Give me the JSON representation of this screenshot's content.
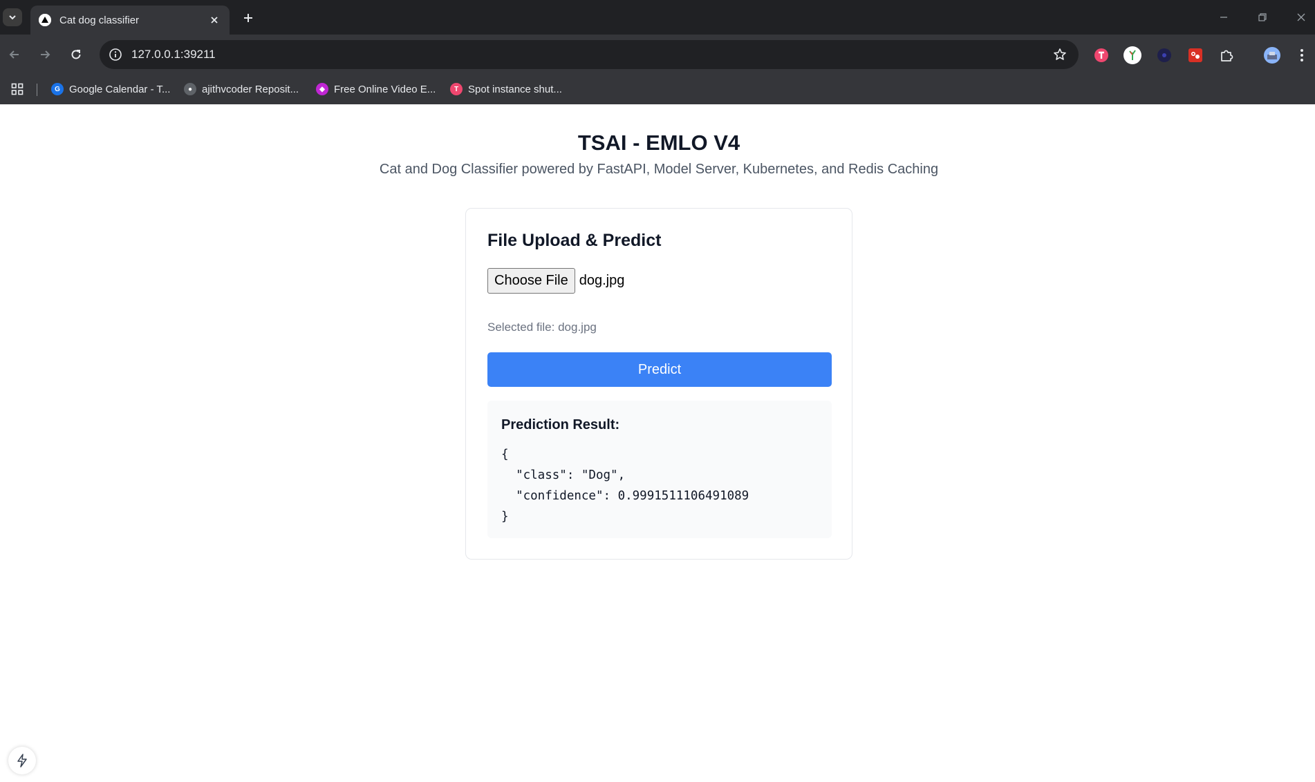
{
  "browser": {
    "tab": {
      "title": "Cat dog classifier"
    },
    "url": "127.0.0.1:39211",
    "bookmarks": [
      {
        "label": "Google Calendar - T...",
        "icon": "google-calendar-icon",
        "color": "#1a73e8"
      },
      {
        "label": "ajithvcoder Reposit...",
        "icon": "github-icon",
        "color": "#5f6368"
      },
      {
        "label": "Free Online Video E...",
        "icon": "video-editor-icon",
        "color": "#c026d3"
      },
      {
        "label": "Spot instance shut...",
        "icon": "spot-instance-icon",
        "color": "#ef476f"
      }
    ]
  },
  "page": {
    "title": "TSAI - EMLO V4",
    "subtitle": "Cat and Dog Classifier powered by FastAPI, Model Server, Kubernetes, and Redis Caching",
    "card": {
      "title": "File Upload & Predict",
      "choose_file_label": "Choose File",
      "file_name": "dog.jpg",
      "selected_file_prefix": "Selected file:",
      "selected_file_name": "dog.jpg",
      "predict_label": "Predict",
      "result_heading": "Prediction Result:",
      "result_json": "{\n  \"class\": \"Dog\",\n  \"confidence\": 0.9991511106491089\n}"
    }
  },
  "colors": {
    "accent": "#3b82f6",
    "chrome_dark": "#202124",
    "chrome_toolbar": "#35363a"
  }
}
